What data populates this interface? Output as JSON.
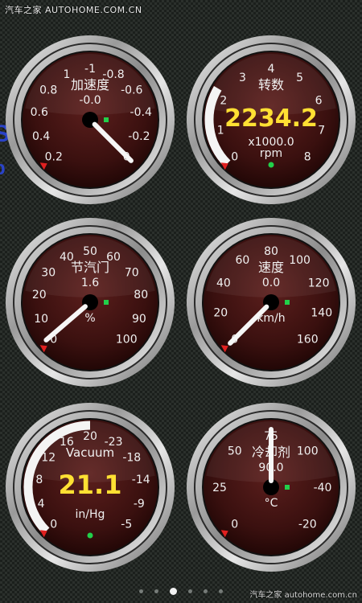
{
  "watermark": {
    "top": "汽车之家 AUTOHOME.COM.CN",
    "bottom": "汽车之家 autohome.com.cn"
  },
  "gauges": [
    {
      "id": "acceleration",
      "title": "加速度",
      "value_text": "-0.0",
      "digital": false,
      "ticks": [
        "0.2",
        "0.4",
        "0.6",
        "0.8",
        "1",
        "-1",
        "-0.8",
        "-0.6",
        "-0.4",
        "-0.2",
        "0"
      ],
      "needle_fraction": 1.0,
      "arc": false
    },
    {
      "id": "rpm",
      "title": "转数",
      "value_text": "2234.2",
      "digital": true,
      "unit_line1": "x1000.0",
      "unit_line2": "rpm",
      "ticks": [
        "0",
        "1",
        "2",
        "3",
        "4",
        "5",
        "6",
        "7",
        "8"
      ],
      "needle_fraction": null,
      "arc": true,
      "arc_fraction": 0.28
    },
    {
      "id": "throttle",
      "title": "节汽门",
      "value_text": "1.6",
      "digital": false,
      "unit_line1": "%",
      "ticks": [
        "0",
        "10",
        "20",
        "30",
        "40",
        "50",
        "60",
        "70",
        "80",
        "90",
        "100"
      ],
      "needle_fraction": 0.016,
      "arc": false
    },
    {
      "id": "speed",
      "title": "速度",
      "value_text": "0.0",
      "digital": false,
      "unit_line1": "km/h",
      "ticks": [
        "0",
        "20",
        "40",
        "60",
        "80",
        "100",
        "120",
        "140",
        "160"
      ],
      "needle_fraction": 0.0,
      "arc": false
    },
    {
      "id": "vacuum",
      "title": "Vacuum",
      "value_text": "21.1",
      "digital": true,
      "unit_line2": "in/Hg",
      "ticks": [
        "0",
        "4",
        "8",
        "12",
        "16",
        "20",
        "-23",
        "-18",
        "-14",
        "-9",
        "-5"
      ],
      "needle_fraction": null,
      "arc": true,
      "arc_fraction": 0.5
    },
    {
      "id": "coolant",
      "title": "冷却剂",
      "value_text": "90.0",
      "digital": false,
      "unit_line1": "°C",
      "ticks": [
        "0",
        "25",
        "50",
        "75",
        "100",
        "-40",
        "-20"
      ],
      "needle_fraction": 0.5,
      "arc": false
    }
  ],
  "pager": {
    "count": 6,
    "active_index": 2
  },
  "background_text": [
    "S",
    "p"
  ]
}
